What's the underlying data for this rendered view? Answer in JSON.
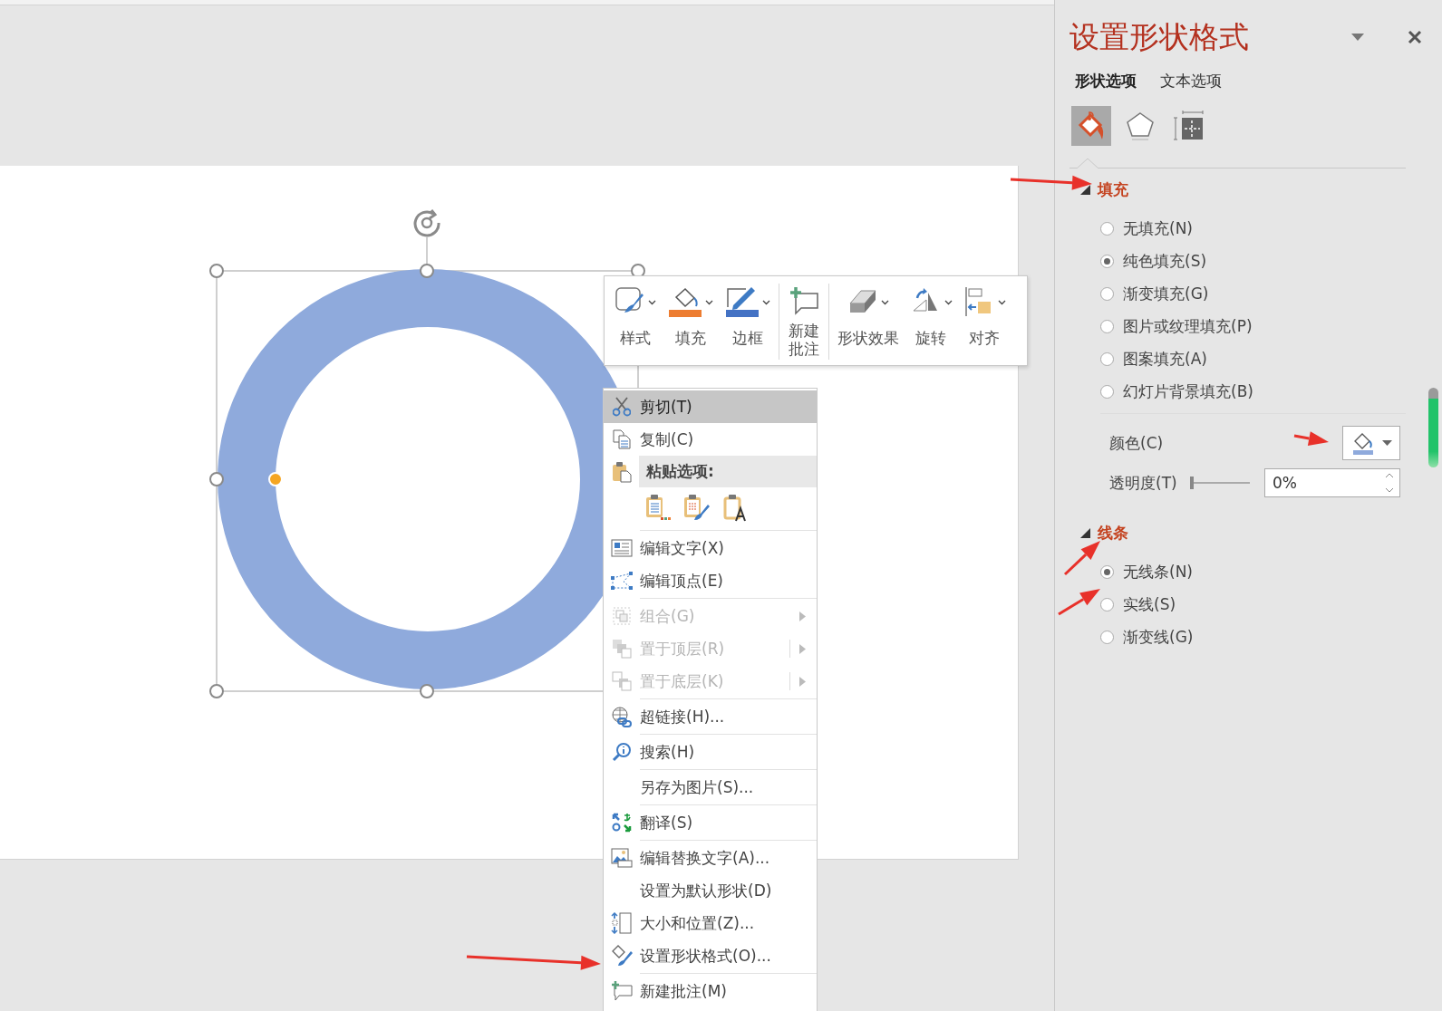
{
  "slide_toolbar": {
    "groups": [
      [
        {
          "label": "样式",
          "kind": "style",
          "dropdown": true
        },
        {
          "label": "填充",
          "kind": "fill",
          "dropdown": true
        },
        {
          "label": "边框",
          "kind": "outline",
          "dropdown": true
        }
      ],
      [
        {
          "label": "新建批注",
          "kind": "comment",
          "dropdown": false
        }
      ],
      [
        {
          "label": "形状效果",
          "kind": "effects",
          "dropdown": true
        },
        {
          "label": "旋转",
          "kind": "rotate",
          "dropdown": true
        },
        {
          "label": "对齐",
          "kind": "align",
          "dropdown": true
        }
      ]
    ]
  },
  "context_menu": {
    "groups": [
      [
        {
          "kind": "cut",
          "label": "剪切(T)",
          "selected": true,
          "disabled": false,
          "submenu": false,
          "split": false
        },
        {
          "kind": "copy",
          "label": "复制(C)",
          "selected": false,
          "disabled": false,
          "submenu": false,
          "split": false
        },
        {
          "kind": "paste_header",
          "label": "粘贴选项:"
        },
        {
          "kind": "paste_options",
          "options": [
            {
              "kind": "use_theme"
            },
            {
              "kind": "keep_source"
            },
            {
              "kind": "text_only"
            }
          ]
        }
      ],
      [
        {
          "kind": "edit_text",
          "label": "编辑文字(X)",
          "selected": false,
          "disabled": false,
          "submenu": false,
          "split": false
        },
        {
          "kind": "edit_points",
          "label": "编辑顶点(E)",
          "selected": false,
          "disabled": false,
          "submenu": false,
          "split": false
        }
      ],
      [
        {
          "kind": "group",
          "label": "组合(G)",
          "selected": false,
          "disabled": true,
          "submenu": true,
          "split": false
        },
        {
          "kind": "bring_front",
          "label": "置于顶层(R)",
          "selected": false,
          "disabled": true,
          "submenu": true,
          "split": true
        },
        {
          "kind": "send_back",
          "label": "置于底层(K)",
          "selected": false,
          "disabled": true,
          "submenu": true,
          "split": true
        }
      ],
      [
        {
          "kind": "hyperlink",
          "label": "超链接(H)...",
          "selected": false,
          "disabled": false,
          "submenu": false,
          "split": false
        }
      ],
      [
        {
          "kind": "search",
          "label": "搜索(H)",
          "selected": false,
          "disabled": false,
          "submenu": false,
          "split": false
        }
      ],
      [
        {
          "kind": "plain",
          "label": "另存为图片(S)...",
          "selected": false,
          "disabled": false,
          "submenu": false,
          "split": false
        }
      ],
      [
        {
          "kind": "translate",
          "label": "翻译(S)",
          "selected": false,
          "disabled": false,
          "submenu": false,
          "split": false
        }
      ],
      [
        {
          "kind": "alt_text",
          "label": "编辑替换文字(A)...",
          "selected": false,
          "disabled": false,
          "submenu": false,
          "split": false
        },
        {
          "kind": "plain",
          "label": "设置为默认形状(D)",
          "selected": false,
          "disabled": false,
          "submenu": false,
          "split": false
        },
        {
          "kind": "size",
          "label": "大小和位置(Z)...",
          "selected": false,
          "disabled": false,
          "submenu": false,
          "split": false
        },
        {
          "kind": "format",
          "label": "设置形状格式(O)...",
          "selected": false,
          "disabled": false,
          "submenu": false,
          "split": false
        }
      ],
      [
        {
          "kind": "comment",
          "label": "新建批注(M)",
          "selected": false,
          "disabled": false,
          "submenu": false,
          "split": false
        }
      ]
    ]
  },
  "format_pane": {
    "title": "设置形状格式",
    "tabs": [
      {
        "label": "形状选项",
        "selected": true
      },
      {
        "label": "文本选项",
        "selected": false
      }
    ],
    "category_icons": [
      {
        "kind": "fill",
        "selected": true
      },
      {
        "kind": "effects",
        "selected": false
      },
      {
        "kind": "size",
        "selected": false
      }
    ],
    "sections": [
      {
        "title": "填充",
        "expanded": true,
        "options": [
          {
            "label": "无填充(N)",
            "selected": false
          },
          {
            "label": "纯色填充(S)",
            "selected": true
          },
          {
            "label": "渐变填充(G)",
            "selected": false
          },
          {
            "label": "图片或纹理填充(P)",
            "selected": false
          },
          {
            "label": "图案填充(A)",
            "selected": false
          },
          {
            "label": "幻灯片背景填充(B)",
            "selected": false
          }
        ],
        "color": {
          "label": "颜色(C)"
        },
        "transparency": {
          "label": "透明度(T)",
          "level": 0,
          "value": "0%"
        }
      },
      {
        "title": "线条",
        "expanded": true,
        "options": [
          {
            "label": "无线条(N)",
            "selected": true
          },
          {
            "label": "实线(S)",
            "selected": false
          },
          {
            "label": "渐变线(G)",
            "selected": false
          }
        ]
      }
    ]
  }
}
